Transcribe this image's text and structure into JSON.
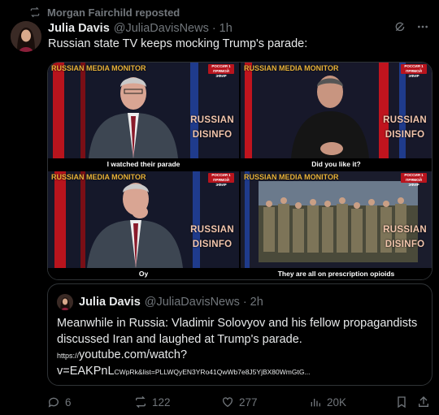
{
  "repost": {
    "text": "Morgan Fairchild reposted",
    "icon": "repost-icon"
  },
  "tweet": {
    "author_name": "Julia Davis",
    "author_handle": "@JuliaDavisNews",
    "separator": "·",
    "time": "1h",
    "text": "Russian state TV keeps mocking Trump's parade:",
    "media": [
      {
        "caption": "I watched their parade",
        "monitor_tag": "RUSSIAN MEDIA MONITOR",
        "disinfo_line1": "RUSSIAN",
        "disinfo_line2": "DISINFO"
      },
      {
        "caption": "Did you like it?",
        "monitor_tag": "RUSSIAN MEDIA MONITOR",
        "disinfo_line1": "RUSSIAN",
        "disinfo_line2": "DISINFO"
      },
      {
        "caption": "Oy",
        "monitor_tag": "RUSSIAN MEDIA MONITOR",
        "disinfo_line1": "RUSSIAN",
        "disinfo_line2": "DISINFO"
      },
      {
        "caption": "They are all on prescription opioids",
        "monitor_tag": "RUSSIAN MEDIA MONITOR",
        "disinfo_line1": "RUSSIAN",
        "disinfo_line2": "DISINFO"
      }
    ],
    "channel_logo_text_1": "РОССИЯ 1",
    "channel_logo_text_2": "ПРЯМОЙ ЭФИР"
  },
  "quote": {
    "author_name": "Julia Davis",
    "author_handle": "@JuliaDavisNews",
    "separator": "·",
    "time": "2h",
    "text": "Meanwhile in Russia: Vladimir Solovyov and his fellow propagandists discussed Iran and laughed at Trump's parade.",
    "link_prefix": "https://",
    "link_main": "youtube.com/watch?",
    "link_line2_main": "v=EAKPnL",
    "link_line2_rest": "CWpRk&list=PLLWQyEN3YRo41QwWb7e8J5YjBX80WmGtG..."
  },
  "actions": {
    "replies": "6",
    "reposts": "122",
    "likes": "277",
    "views": "20K"
  },
  "colors": {
    "background": "#000000",
    "text": "#e7e9ea",
    "muted": "#71767b",
    "border": "#2f3336"
  }
}
